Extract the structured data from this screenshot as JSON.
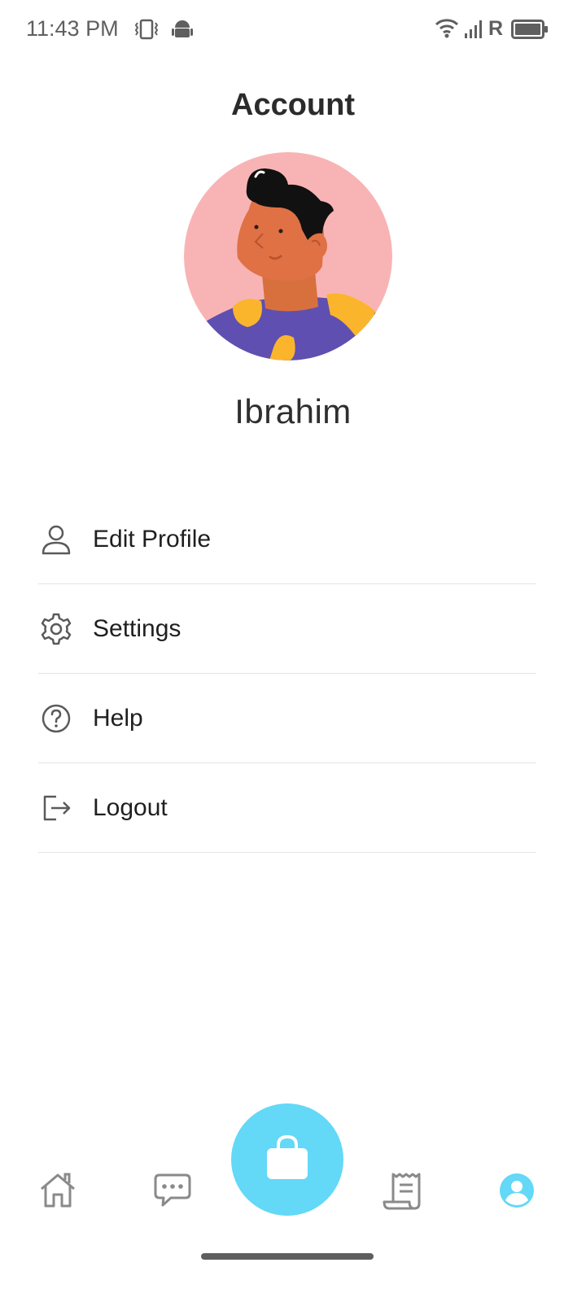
{
  "status_bar": {
    "time": "11:43 PM",
    "icons": [
      "vibrate-icon",
      "android-icon",
      "wifi-icon",
      "signal-icon",
      "roaming-icon",
      "battery-icon"
    ],
    "roaming_label": "R"
  },
  "header": {
    "title": "Account"
  },
  "profile": {
    "name": "Ibrahim"
  },
  "menu": {
    "items": [
      {
        "label": "Edit Profile",
        "icon": "person-icon"
      },
      {
        "label": "Settings",
        "icon": "gear-icon"
      },
      {
        "label": "Help",
        "icon": "help-icon"
      },
      {
        "label": "Logout",
        "icon": "logout-icon"
      }
    ]
  },
  "bottom_nav": {
    "items": [
      "home-icon",
      "chat-icon",
      "shopping-bag-icon",
      "receipt-icon",
      "account-icon"
    ],
    "active": "account-icon"
  },
  "colors": {
    "accent": "#63d8f7",
    "icon_gray": "#8a8a8a",
    "avatar_bg": "#f8b4b5"
  }
}
